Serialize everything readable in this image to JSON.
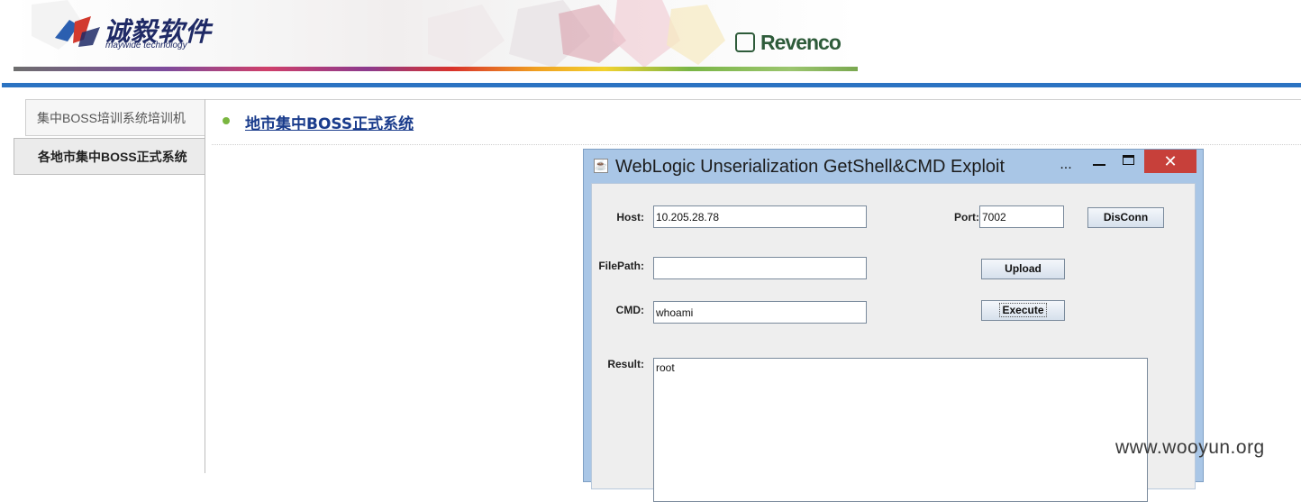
{
  "banner": {
    "logo_cn": "诚毅软件",
    "logo_en": "maywide technology",
    "partner": "Revenco"
  },
  "sidebar": {
    "tabs": [
      {
        "label": "集中BOSS培训系统培训机"
      },
      {
        "label": "各地市集中BOSS正式系统"
      }
    ]
  },
  "main": {
    "system_title": "地市集中BOSS正式系统"
  },
  "window": {
    "title": "WebLogic Unserialization GetShell&CMD Exploit",
    "overflow_glyph": "...",
    "close_glyph": "✕",
    "host_label": "Host:",
    "host_value": "10.205.28.78",
    "port_label": "Port:",
    "port_value": "7002",
    "disconn_label": "DisConn",
    "filepath_label": "FilePath:",
    "filepath_value": "",
    "upload_label": "Upload",
    "cmd_label": "CMD:",
    "cmd_value": "whoami",
    "execute_label": "Execute",
    "result_label": "Result:",
    "result_value": "root"
  },
  "watermark": "www.wooyun.org",
  "colors": {
    "accent_blue": "#2b73c2",
    "link": "#1a3c8c",
    "bullet": "#7ab640",
    "close_red": "#c7403a",
    "window_frame": "#a9c6e6"
  }
}
